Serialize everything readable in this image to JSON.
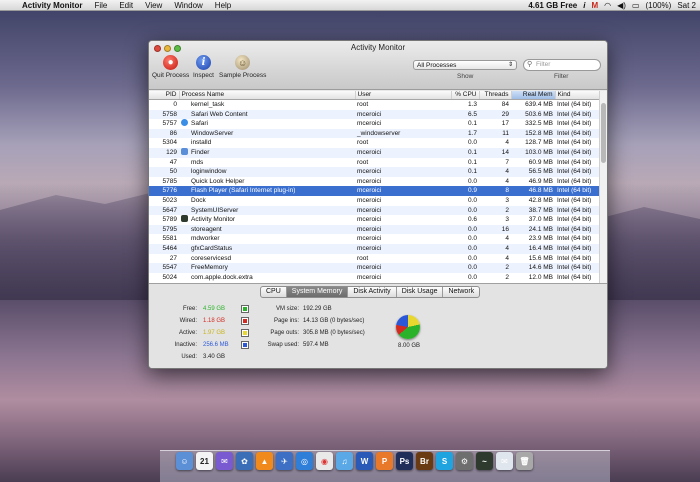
{
  "menubar": {
    "apple": "",
    "app_name": "Activity Monitor",
    "items": [
      "File",
      "Edit",
      "View",
      "Window",
      "Help"
    ],
    "free_mem": "4.61 GB Free",
    "battery": "(100%)",
    "clock": "Sat 2"
  },
  "window": {
    "title": "Activity Monitor",
    "toolbar": {
      "quit_label": "Quit Process",
      "inspect_label": "Inspect",
      "sample_label": "Sample Process",
      "show_label": "Show",
      "filter_label": "Filter",
      "process_filter": "All Processes",
      "search_placeholder": "Filter"
    },
    "columns": [
      "PID",
      "Process Name",
      "User",
      "% CPU",
      "Threads",
      "Real Mem",
      "Kind"
    ],
    "rows": [
      {
        "pid": "0",
        "name": "kernel_task",
        "user": "root",
        "cpu": "1.3",
        "threads": "84",
        "mem": "639.4 MB",
        "kind": "Intel (64 bit)"
      },
      {
        "pid": "5758",
        "name": "Safari Web Content",
        "user": "mceroici",
        "cpu": "6.5",
        "threads": "29",
        "mem": "503.6 MB",
        "kind": "Intel (64 bit)"
      },
      {
        "pid": "5757",
        "name": "Safari",
        "user": "mceroici",
        "cpu": "0.1",
        "threads": "17",
        "mem": "332.5 MB",
        "kind": "Intel (64 bit)"
      },
      {
        "pid": "86",
        "name": "WindowServer",
        "user": "_windowserver",
        "cpu": "1.7",
        "threads": "11",
        "mem": "152.8 MB",
        "kind": "Intel (64 bit)"
      },
      {
        "pid": "5304",
        "name": "installd",
        "user": "root",
        "cpu": "0.0",
        "threads": "4",
        "mem": "128.7 MB",
        "kind": "Intel (64 bit)"
      },
      {
        "pid": "129",
        "name": "Finder",
        "user": "mceroici",
        "cpu": "0.1",
        "threads": "14",
        "mem": "103.0 MB",
        "kind": "Intel (64 bit)"
      },
      {
        "pid": "47",
        "name": "mds",
        "user": "root",
        "cpu": "0.1",
        "threads": "7",
        "mem": "60.9 MB",
        "kind": "Intel (64 bit)"
      },
      {
        "pid": "50",
        "name": "loginwindow",
        "user": "mceroici",
        "cpu": "0.1",
        "threads": "4",
        "mem": "56.5 MB",
        "kind": "Intel (64 bit)"
      },
      {
        "pid": "5785",
        "name": "Quick Look Helper",
        "user": "mceroici",
        "cpu": "0.0",
        "threads": "4",
        "mem": "46.9 MB",
        "kind": "Intel (64 bit)"
      },
      {
        "pid": "5776",
        "name": "Flash Player (Safari Internet plug-in)",
        "user": "mceroici",
        "cpu": "0.9",
        "threads": "8",
        "mem": "46.8 MB",
        "kind": "Intel (64 bit)"
      },
      {
        "pid": "5023",
        "name": "Dock",
        "user": "mceroici",
        "cpu": "0.0",
        "threads": "3",
        "mem": "42.8 MB",
        "kind": "Intel (64 bit)"
      },
      {
        "pid": "5647",
        "name": "SystemUIServer",
        "user": "mceroici",
        "cpu": "0.0",
        "threads": "2",
        "mem": "38.7 MB",
        "kind": "Intel (64 bit)"
      },
      {
        "pid": "5789",
        "name": "Activity Monitor",
        "user": "mceroici",
        "cpu": "0.6",
        "threads": "3",
        "mem": "37.0 MB",
        "kind": "Intel (64 bit)"
      },
      {
        "pid": "5795",
        "name": "storeagent",
        "user": "mceroici",
        "cpu": "0.0",
        "threads": "16",
        "mem": "24.1 MB",
        "kind": "Intel (64 bit)"
      },
      {
        "pid": "5581",
        "name": "mdworker",
        "user": "mceroici",
        "cpu": "0.0",
        "threads": "4",
        "mem": "23.9 MB",
        "kind": "Intel (64 bit)"
      },
      {
        "pid": "5464",
        "name": "gfxCardStatus",
        "user": "mceroici",
        "cpu": "0.0",
        "threads": "4",
        "mem": "16.4 MB",
        "kind": "Intel (64 bit)"
      },
      {
        "pid": "27",
        "name": "coreservicesd",
        "user": "root",
        "cpu": "0.0",
        "threads": "4",
        "mem": "15.6 MB",
        "kind": "Intel (64 bit)"
      },
      {
        "pid": "5547",
        "name": "FreeMemory",
        "user": "mceroici",
        "cpu": "0.0",
        "threads": "2",
        "mem": "14.6 MB",
        "kind": "Intel (64 bit)"
      },
      {
        "pid": "5024",
        "name": "com.apple.dock.extra",
        "user": "mceroici",
        "cpu": "0.0",
        "threads": "2",
        "mem": "12.0 MB",
        "kind": "Intel (64 bit)"
      }
    ],
    "selected_row_index": 9,
    "tabs": [
      "CPU",
      "System Memory",
      "Disk Activity",
      "Disk Usage",
      "Network"
    ],
    "active_tab": "System Memory",
    "memory": {
      "free_label": "Free:",
      "free_value": "4.59 GB",
      "wired_label": "Wired:",
      "wired_value": "1.18 GB",
      "active_label": "Active:",
      "active_value": "1.97 GB",
      "inactive_label": "Inactive:",
      "inactive_value": "256.6 MB",
      "used_label": "Used:",
      "used_value": "3.40 GB",
      "vm_size_label": "VM size:",
      "vm_size_value": "192.29 GB",
      "page_ins_label": "Page ins:",
      "page_ins_value": "14.13 GB (0 bytes/sec)",
      "page_outs_label": "Page outs:",
      "page_outs_value": "305.8 MB (0 bytes/sec)",
      "swap_label": "Swap used:",
      "swap_value": "597.4 MB",
      "total_label": "8.00 GB"
    },
    "colors": {
      "free": "#2ab32a",
      "wired": "#d32b22",
      "active": "#e7d72f",
      "inactive": "#2c58d8",
      "selection": "#3a6fd0"
    }
  },
  "dock": {
    "icons": [
      "finder-icon",
      "calendar-icon",
      "preview-icon",
      "iphoto-icon",
      "vlc-icon",
      "cyberduck-icon",
      "safari-icon",
      "chrome-icon",
      "itunes-icon",
      "word-icon",
      "pages-icon",
      "photoshop-icon",
      "bridge-icon",
      "skype-icon",
      "utility-icon",
      "activity-monitor-icon",
      "mail-icon",
      "trash-icon"
    ],
    "calendar_day": "21"
  }
}
